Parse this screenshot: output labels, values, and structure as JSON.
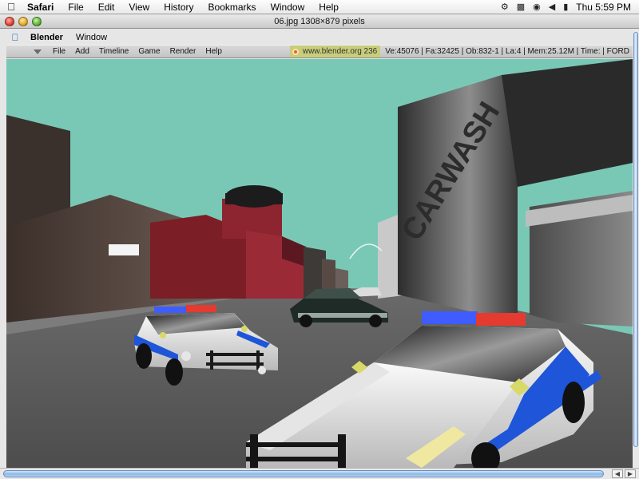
{
  "menubar": {
    "app_name": "Safari",
    "items": [
      "File",
      "Edit",
      "View",
      "History",
      "Bookmarks",
      "Window",
      "Help"
    ],
    "clock": "Thu 5:59 PM"
  },
  "window": {
    "title": "06.jpg 1308×879 pixels"
  },
  "blender": {
    "menubar": {
      "app_name": "Blender",
      "items": [
        "Window"
      ]
    },
    "header_menu": [
      "File",
      "Add",
      "Timeline",
      "Game",
      "Render",
      "Help"
    ],
    "website_label": "www.blender.org 236",
    "stats": "Ve:45076 | Fa:32425 | Ob:832-1 | La:4 | Mem:25.12M | Time: | FORD"
  },
  "scene": {
    "billboard_text": "CARWASH",
    "colors": {
      "sky": "#79c8b6",
      "road": "#5b5b5b",
      "police_blue": "#1f55d8",
      "light_red": "#e43a2f",
      "light_blue": "#3f5cff"
    }
  }
}
